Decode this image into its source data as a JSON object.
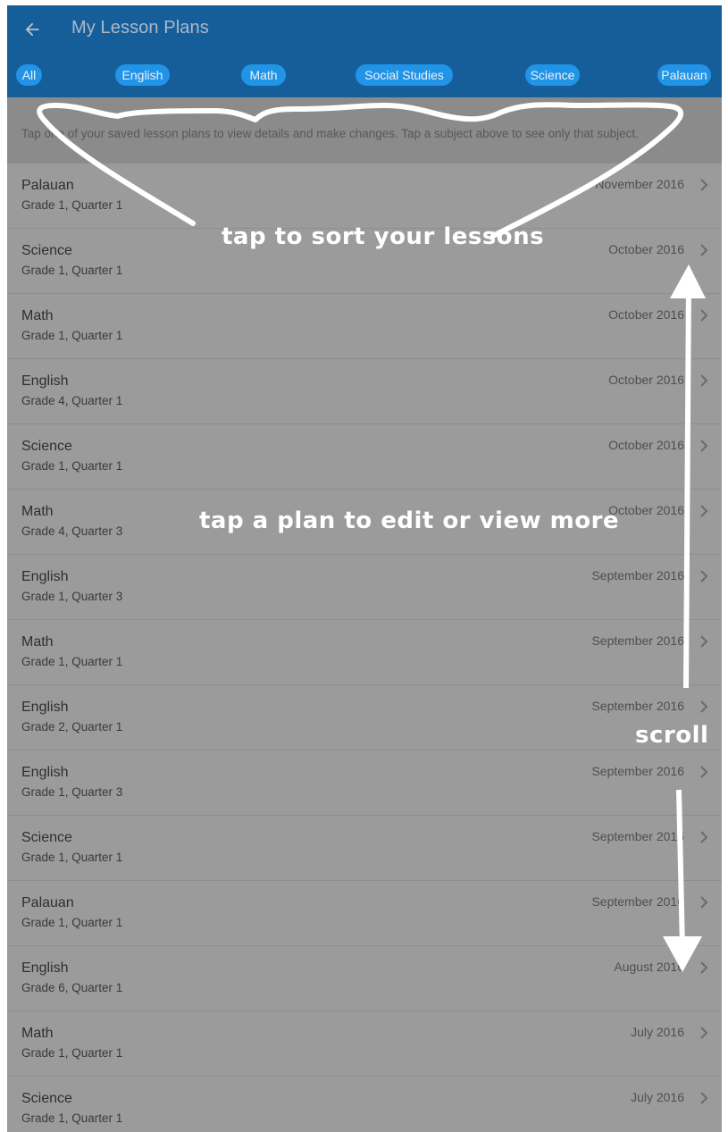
{
  "appbar": {
    "title": "My Lesson Plans",
    "back_icon": "arrow-left-icon",
    "filters": [
      "All",
      "English",
      "Math",
      "Social Studies",
      "Science",
      "Palauan"
    ],
    "selected_filter": "All"
  },
  "instructions": "Tap one of your saved lesson plans to view details and make changes. Tap a subject above to see only that subject.",
  "lessons": [
    {
      "subject": "Palauan",
      "grade": "Grade 1, Quarter 1",
      "date": "November 2016"
    },
    {
      "subject": "Science",
      "grade": "Grade 1, Quarter 1",
      "date": "October 2016"
    },
    {
      "subject": "Math",
      "grade": "Grade 1, Quarter 1",
      "date": "October 2016"
    },
    {
      "subject": "English",
      "grade": "Grade 4, Quarter 1",
      "date": "October 2016"
    },
    {
      "subject": "Science",
      "grade": "Grade 1, Quarter 1",
      "date": "October 2016"
    },
    {
      "subject": "Math",
      "grade": "Grade 4, Quarter 3",
      "date": "October 2016"
    },
    {
      "subject": "English",
      "grade": "Grade 1, Quarter 3",
      "date": "September 2016"
    },
    {
      "subject": "Math",
      "grade": "Grade 1, Quarter 1",
      "date": "September 2016"
    },
    {
      "subject": "English",
      "grade": "Grade 2, Quarter 1",
      "date": "September 2016"
    },
    {
      "subject": "English",
      "grade": "Grade 1, Quarter 3",
      "date": "September 2016"
    },
    {
      "subject": "Science",
      "grade": "Grade 1, Quarter 1",
      "date": "September 2016"
    },
    {
      "subject": "Palauan",
      "grade": "Grade 1, Quarter 1",
      "date": "September 2016"
    },
    {
      "subject": "English",
      "grade": "Grade 6, Quarter 1",
      "date": "August 2016"
    },
    {
      "subject": "Math",
      "grade": "Grade 1, Quarter 1",
      "date": "July 2016"
    },
    {
      "subject": "Science",
      "grade": "Grade 1, Quarter 1",
      "date": "July 2016"
    }
  ],
  "row_icon": "chevron-right-icon",
  "annotations": {
    "sort": "tap to sort your lessons",
    "edit": "tap a plan to edit or view more",
    "scroll": "scroll"
  },
  "colors": {
    "appbar": "#155e9a",
    "chip": "#2294e7",
    "overlay_background": "#9b9b9b",
    "annotation": "#ffffff"
  }
}
